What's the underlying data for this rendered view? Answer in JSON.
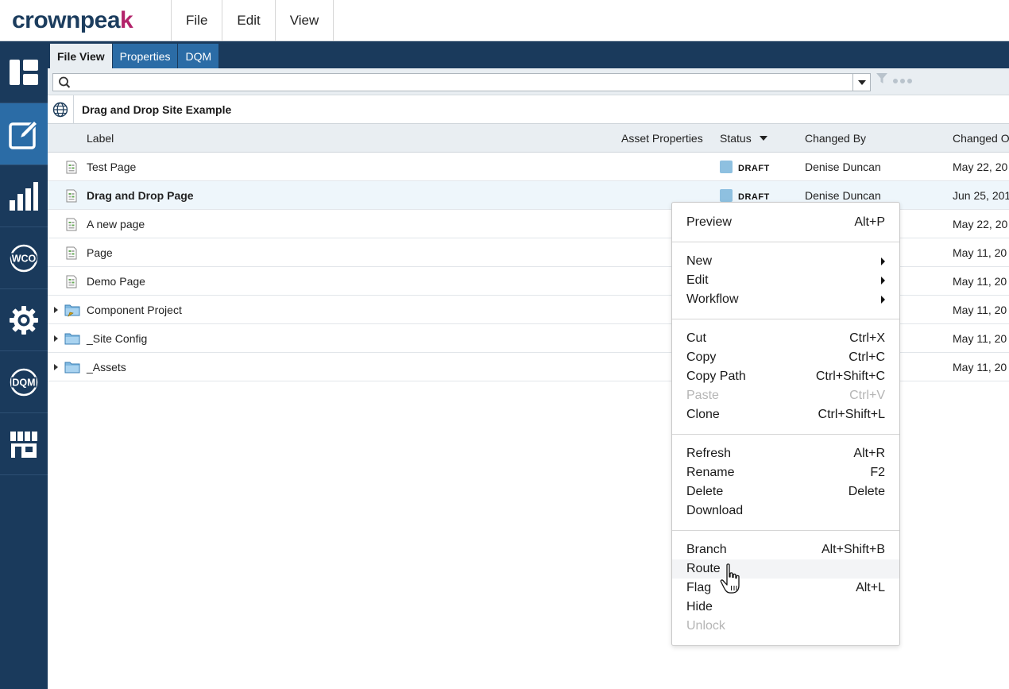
{
  "brand": {
    "name_main": "crownpea",
    "name_accent": "k"
  },
  "menubar": [
    {
      "label": "File"
    },
    {
      "label": "Edit"
    },
    {
      "label": "View"
    }
  ],
  "sidebar": [
    {
      "name": "dashboard-icon"
    },
    {
      "name": "edit-icon",
      "active": true
    },
    {
      "name": "analytics-icon"
    },
    {
      "name": "wco-icon",
      "text": "WCO"
    },
    {
      "name": "settings-icon"
    },
    {
      "name": "dqm-icon",
      "text": "DQM"
    },
    {
      "name": "marketplace-icon"
    }
  ],
  "tabs": [
    {
      "label": "File View"
    },
    {
      "label": "Properties"
    },
    {
      "label": "DQM"
    }
  ],
  "search": {
    "placeholder": "",
    "value": ""
  },
  "path": {
    "label": "Drag and Drop Site Example"
  },
  "columns": {
    "label": "Label",
    "asset_properties": "Asset Properties",
    "status": "Status",
    "changed_by": "Changed By",
    "changed_on": "Changed O"
  },
  "rows": [
    {
      "label": "Test Page",
      "type": "page",
      "status": "DRAFT",
      "changed_by": "Denise Duncan",
      "changed_on": "May 22, 20"
    },
    {
      "label": "Drag and Drop Page",
      "type": "page",
      "status": "DRAFT",
      "changed_by": "Denise Duncan",
      "changed_on": "Jun 25, 201",
      "selected": true
    },
    {
      "label": "A new page",
      "type": "page",
      "status": "",
      "changed_by": "",
      "changed_on": "May 22, 20"
    },
    {
      "label": "Page",
      "type": "page",
      "status": "",
      "changed_by": "",
      "changed_on": "May 11, 20"
    },
    {
      "label": "Demo Page",
      "type": "page",
      "status": "",
      "changed_by": "",
      "changed_on": "May 11, 20"
    },
    {
      "label": "Component Project",
      "type": "project",
      "status": "",
      "changed_by": "",
      "changed_on": "May 11, 20"
    },
    {
      "label": "_Site Config",
      "type": "folder",
      "status": "",
      "changed_by": "",
      "changed_on": "May 11, 20"
    },
    {
      "label": "_Assets",
      "type": "folder",
      "status": "",
      "changed_by": "",
      "changed_on": "May 11, 20"
    }
  ],
  "status_color": "#8ec0e0",
  "context_menu": {
    "groups": [
      [
        {
          "label": "Preview",
          "shortcut": "Alt+P"
        }
      ],
      [
        {
          "label": "New",
          "submenu": true
        },
        {
          "label": "Edit",
          "submenu": true
        },
        {
          "label": "Workflow",
          "submenu": true
        }
      ],
      [
        {
          "label": "Cut",
          "shortcut": "Ctrl+X"
        },
        {
          "label": "Copy",
          "shortcut": "Ctrl+C"
        },
        {
          "label": "Copy Path",
          "shortcut": "Ctrl+Shift+C"
        },
        {
          "label": "Paste",
          "shortcut": "Ctrl+V",
          "disabled": true
        },
        {
          "label": "Clone",
          "shortcut": "Ctrl+Shift+L"
        }
      ],
      [
        {
          "label": "Refresh",
          "shortcut": "Alt+R"
        },
        {
          "label": "Rename",
          "shortcut": "F2"
        },
        {
          "label": "Delete",
          "shortcut": "Delete"
        },
        {
          "label": "Download",
          "shortcut": ""
        }
      ],
      [
        {
          "label": "Branch",
          "shortcut": "Alt+Shift+B"
        },
        {
          "label": "Route",
          "shortcut": "",
          "hover": true
        },
        {
          "label": "Flag",
          "shortcut": "Alt+L"
        },
        {
          "label": "Hide",
          "shortcut": ""
        },
        {
          "label": "Unlock",
          "shortcut": "",
          "disabled": true
        }
      ]
    ]
  }
}
